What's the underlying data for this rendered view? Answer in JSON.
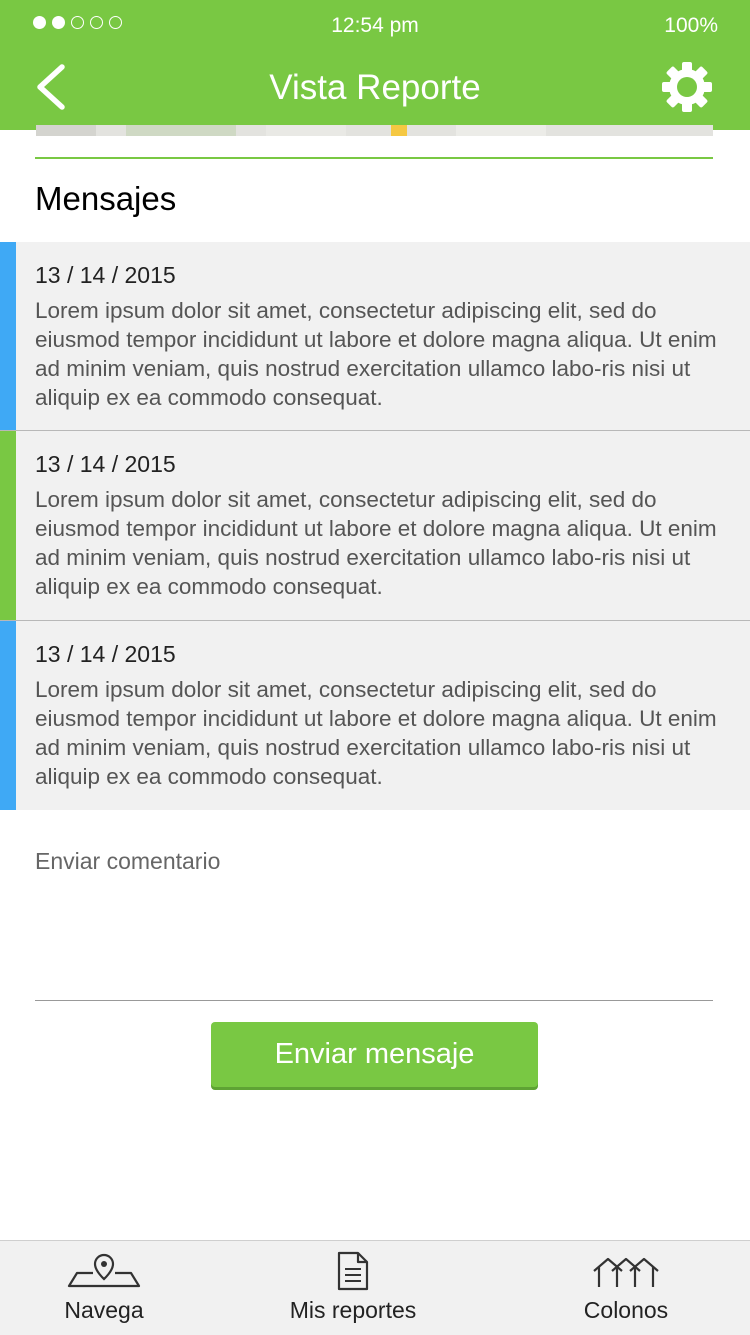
{
  "status_bar": {
    "signal_dots": [
      "filled",
      "filled",
      "empty",
      "empty",
      "empty"
    ],
    "time": "12:54 pm",
    "battery": "100%"
  },
  "header": {
    "title": "Vista Reporte",
    "back_icon": "chevron-left-icon",
    "settings_icon": "gear-icon",
    "background_color": "#79c843"
  },
  "messages_section": {
    "title": "Mensajes",
    "items": [
      {
        "date": "13 / 14 / 2015",
        "text": "Lorem ipsum dolor sit amet, consectetur adipiscing elit, sed do eiusmod tempor incididunt ut labore et dolore magna aliqua. Ut enim ad minim veniam, quis nostrud exercitation ullamco labo-ris nisi ut aliquip ex ea commodo consequat.",
        "accent": "#3fa9f5"
      },
      {
        "date": "13 / 14 / 2015",
        "text": "Lorem ipsum dolor sit amet, consectetur adipiscing elit, sed do eiusmod tempor incididunt ut labore et dolore magna aliqua. Ut enim ad minim veniam, quis nostrud exercitation ullamco labo-ris nisi ut aliquip ex ea commodo consequat.",
        "accent": "#79c843"
      },
      {
        "date": "13 / 14 / 2015",
        "text": "Lorem ipsum dolor sit amet, consectetur adipiscing elit, sed do eiusmod tempor incididunt ut labore et dolore magna aliqua. Ut enim ad minim veniam, quis nostrud exercitation ullamco labo-ris nisi ut aliquip ex ea commodo consequat.",
        "accent": "#3fa9f5"
      }
    ]
  },
  "comment": {
    "placeholder": "Enviar comentario",
    "send_label": "Enviar mensaje"
  },
  "bottom_nav": {
    "items": [
      {
        "label": "Navega",
        "icon": "map-pin-icon"
      },
      {
        "label": "Mis reportes",
        "icon": "document-icon"
      },
      {
        "label": "Colonos",
        "icon": "houses-icon"
      }
    ]
  }
}
